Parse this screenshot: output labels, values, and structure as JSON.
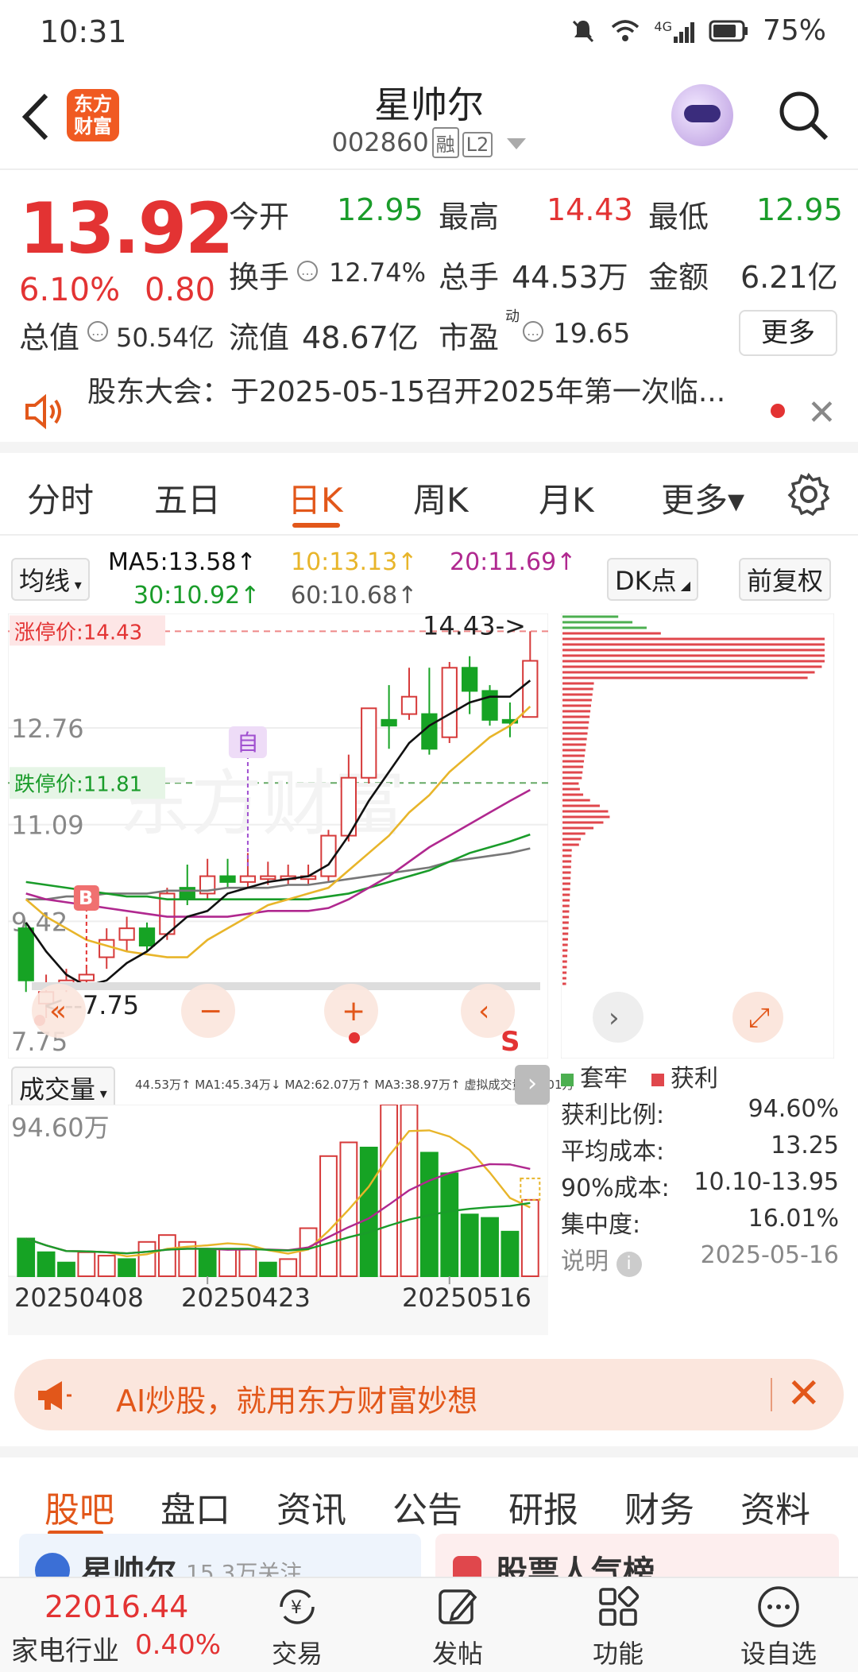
{
  "status_bar": {
    "time": "10:31",
    "network": "4G",
    "battery": "75%"
  },
  "header": {
    "logo_line1": "东方",
    "logo_line2": "财富",
    "title": "星帅尔",
    "code": "002860",
    "tag_margin": "融",
    "tag_l2": "L2"
  },
  "quote": {
    "price": "13.92",
    "change_pct": "6.10%",
    "change_amt": "0.80",
    "open_label": "今开",
    "open": "12.95",
    "high_label": "最高",
    "high": "14.43",
    "low_label": "最低",
    "low": "12.95",
    "turnover_label": "换手",
    "turnover": "12.74%",
    "volume_label": "总手",
    "volume": "44.53万",
    "amount_label": "金额",
    "amount": "6.21亿",
    "mktcap_label": "总值",
    "mktcap": "50.54亿",
    "float_label": "流值",
    "float": "48.67亿",
    "pe_label": "市盈",
    "pe_sup": "动",
    "pe": "19.65",
    "more_label": "更多"
  },
  "notice": {
    "text": "股东大会：于2025-05-15召开2025年第一次临..."
  },
  "kline_tabs": [
    "分时",
    "五日",
    "日K",
    "周K",
    "月K",
    "更多▾"
  ],
  "active_kline_tab": "日K",
  "ma_bar": {
    "selector": "均线",
    "ma5": "MA5:13.58↑",
    "ma10": "10:13.13↑",
    "ma20": "20:11.69↑",
    "ma30": "30:10.92↑",
    "ma60": "60:10.68↑",
    "dk_label": "DK点",
    "adjust_label": "前复权",
    "colors": {
      "ma5": "#111111",
      "ma10": "#e8b52a",
      "ma20": "#b0288f",
      "ma30": "#1a9c2a",
      "ma60": "#777777"
    }
  },
  "chart_data": [
    {
      "type": "candlestick",
      "title": "",
      "y_ticks": [
        "12.76",
        "11.09",
        "9.42",
        "7.75"
      ],
      "ylim": [
        7.6,
        14.6
      ],
      "limit_up_label": "涨停价:14.43",
      "limit_down_label": "跌停价:11.81",
      "high_marker": "14.43->",
      "low_marker": "<--7.75",
      "auto_marker": "自",
      "buy_marker": "B",
      "sell_marker": "S",
      "candles": [
        {
          "o": 9.3,
          "c": 8.4,
          "h": 9.4,
          "l": 8.2
        },
        {
          "o": 8.0,
          "c": 8.2,
          "h": 8.5,
          "l": 7.75
        },
        {
          "o": 8.3,
          "c": 8.4,
          "h": 8.6,
          "l": 8.2
        },
        {
          "o": 8.4,
          "c": 8.5,
          "h": 8.6,
          "l": 8.3
        },
        {
          "o": 8.8,
          "c": 9.1,
          "h": 9.3,
          "l": 8.6
        },
        {
          "o": 9.1,
          "c": 9.3,
          "h": 9.5,
          "l": 8.9
        },
        {
          "o": 9.3,
          "c": 9.0,
          "h": 9.4,
          "l": 8.9
        },
        {
          "o": 9.2,
          "c": 9.9,
          "h": 10.0,
          "l": 9.1
        },
        {
          "o": 10.0,
          "c": 9.8,
          "h": 10.4,
          "l": 9.7
        },
        {
          "o": 9.9,
          "c": 10.2,
          "h": 10.5,
          "l": 9.8
        },
        {
          "o": 10.2,
          "c": 10.1,
          "h": 10.5,
          "l": 10.0
        },
        {
          "o": 10.1,
          "c": 10.2,
          "h": 10.6,
          "l": 10.0
        },
        {
          "o": 10.15,
          "c": 10.2,
          "h": 10.45,
          "l": 10.05
        },
        {
          "o": 10.15,
          "c": 10.2,
          "h": 10.4,
          "l": 10.05
        },
        {
          "o": 10.15,
          "c": 10.2,
          "h": 10.4,
          "l": 10.05
        },
        {
          "o": 10.2,
          "c": 10.9,
          "h": 11.0,
          "l": 10.1
        },
        {
          "o": 10.9,
          "c": 11.9,
          "h": 12.3,
          "l": 10.8
        },
        {
          "o": 11.9,
          "c": 13.1,
          "h": 13.1,
          "l": 11.8
        },
        {
          "o": 12.9,
          "c": 12.8,
          "h": 13.5,
          "l": 12.4
        },
        {
          "o": 13.0,
          "c": 13.3,
          "h": 13.8,
          "l": 12.9
        },
        {
          "o": 13.0,
          "c": 12.4,
          "h": 13.8,
          "l": 12.3
        },
        {
          "o": 12.6,
          "c": 13.8,
          "h": 13.9,
          "l": 12.5
        },
        {
          "o": 13.8,
          "c": 13.4,
          "h": 14.0,
          "l": 13.0
        },
        {
          "o": 13.4,
          "c": 12.9,
          "h": 13.5,
          "l": 12.8
        },
        {
          "o": 12.9,
          "c": 12.85,
          "h": 13.2,
          "l": 12.6
        },
        {
          "o": 12.95,
          "c": 13.92,
          "h": 14.43,
          "l": 12.95
        }
      ],
      "ma5": [
        9.4,
        8.9,
        8.5,
        8.3,
        8.4,
        8.7,
        8.9,
        9.2,
        9.5,
        9.6,
        9.9,
        10.0,
        10.1,
        10.15,
        10.2,
        10.4,
        10.9,
        11.5,
        12.0,
        12.5,
        12.8,
        13.0,
        13.2,
        13.3,
        13.3,
        13.58
      ],
      "ma10": [
        9.8,
        9.5,
        9.3,
        9.1,
        9.0,
        8.9,
        8.85,
        8.8,
        8.8,
        9.1,
        9.3,
        9.5,
        9.7,
        9.8,
        9.9,
        10.0,
        10.3,
        10.6,
        10.9,
        11.3,
        11.6,
        12.0,
        12.3,
        12.6,
        12.8,
        13.13
      ],
      "ma20": [
        9.9,
        9.8,
        9.75,
        9.7,
        9.65,
        9.6,
        9.55,
        9.5,
        9.5,
        9.5,
        9.5,
        9.55,
        9.6,
        9.6,
        9.6,
        9.65,
        9.8,
        10.0,
        10.2,
        10.45,
        10.7,
        10.9,
        11.1,
        11.3,
        11.5,
        11.69
      ],
      "ma30": [
        10.1,
        10.05,
        10.0,
        9.95,
        9.9,
        9.85,
        9.85,
        9.8,
        9.8,
        9.8,
        9.8,
        9.8,
        9.8,
        9.8,
        9.8,
        9.85,
        9.9,
        10.0,
        10.1,
        10.2,
        10.3,
        10.45,
        10.6,
        10.7,
        10.8,
        10.92
      ],
      "ma60": [
        9.8,
        9.8,
        9.85,
        9.85,
        9.9,
        9.9,
        9.9,
        9.95,
        9.95,
        9.95,
        10.0,
        10.0,
        10.0,
        10.05,
        10.05,
        10.1,
        10.15,
        10.2,
        10.25,
        10.3,
        10.35,
        10.45,
        10.5,
        10.55,
        10.6,
        10.68
      ]
    },
    {
      "type": "bar",
      "title": "成交量",
      "legend_text": "44.53万↑ MA1:45.34万↓ MA2:62.07万↑ MA3:38.97万↑ 虚拟成交量:57.01万",
      "y_tick": "94.60万",
      "x_ticks": [
        "20250408",
        "20250423",
        "20250516"
      ],
      "values": [
        22,
        14,
        8,
        14,
        12,
        10,
        20,
        24,
        20,
        16,
        16,
        16,
        8,
        10,
        28,
        70,
        78,
        75,
        100,
        100,
        72,
        60,
        36,
        34,
        26,
        44.5
      ],
      "up": [
        false,
        false,
        false,
        true,
        true,
        false,
        true,
        true,
        true,
        false,
        true,
        true,
        false,
        true,
        true,
        true,
        true,
        false,
        true,
        true,
        false,
        false,
        false,
        false,
        false,
        true
      ],
      "ylim": [
        0,
        100
      ]
    }
  ],
  "chip": {
    "legend_trapped": "套牢",
    "legend_profit": "获利",
    "profit_ratio_label": "获利比例:",
    "profit_ratio": "94.60%",
    "avg_cost_label": "平均成本:",
    "avg_cost": "13.25",
    "cost90_label": "90%成本:",
    "cost90": "10.10-13.95",
    "concentration_label": "集中度:",
    "concentration": "16.01%",
    "note_label": "说明",
    "date": "2025-05-16",
    "colors": {
      "trapped": "#4caf50",
      "profit": "#e0474c"
    }
  },
  "ai_banner": {
    "text": "AI炒股，就用东方财富妙想"
  },
  "bottom_tabs": [
    "股吧",
    "盘口",
    "资讯",
    "公告",
    "研报",
    "财务",
    "资料"
  ],
  "active_bottom_tab": "股吧",
  "cards": {
    "card1_title": "星帅尔",
    "card1_sub": "15.3万关注",
    "card2_title": "股票人气榜"
  },
  "footer": {
    "index_value": "22016.44",
    "industry_label": "家电行业",
    "industry_change": "0.40%",
    "buttons": [
      "交易",
      "发帖",
      "功能",
      "设自选"
    ]
  }
}
